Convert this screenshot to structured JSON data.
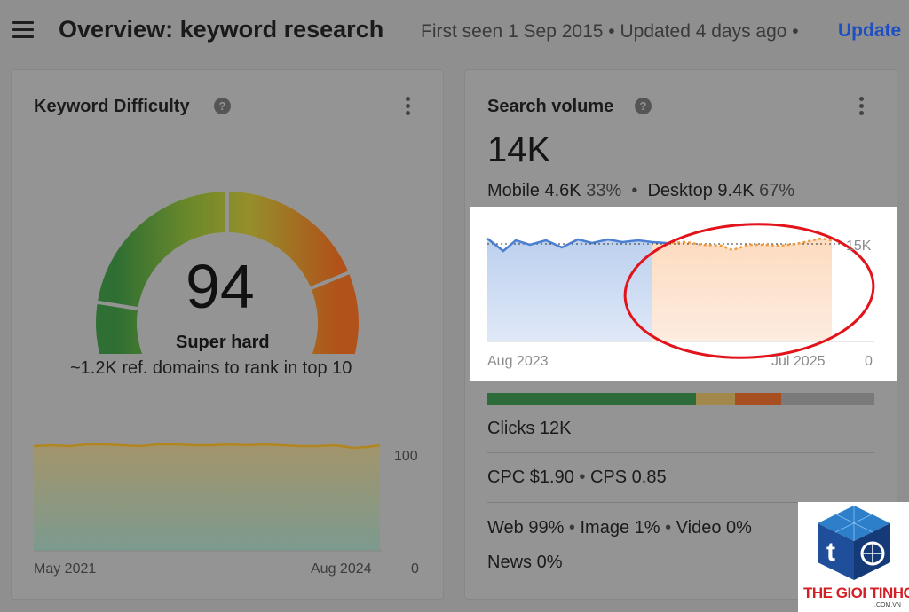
{
  "header": {
    "title": "Overview: keyword research",
    "meta": "First seen 1 Sep 2015 • Updated 4 days ago •",
    "update_label": "Update"
  },
  "keyword_difficulty": {
    "title": "Keyword Difficulty",
    "help": "?",
    "value": "94",
    "gauge_fraction": 0.94,
    "label": "Super hard",
    "subtext": "~1.2K ref. domains to rank in top 10",
    "chart": {
      "x_start": "May 2021",
      "x_end": "Aug 2024",
      "y_max": "100",
      "y_min": "0"
    }
  },
  "search_volume": {
    "title": "Search volume",
    "help": "?",
    "value": "14K",
    "mobile_label": "Mobile",
    "mobile_value": "4.6K",
    "mobile_pct": "33%",
    "desktop_label": "Desktop",
    "desktop_value": "9.4K",
    "desktop_pct": "67%",
    "chart": {
      "y_max": "15K",
      "y_min": "0",
      "x_start": "Aug 2023",
      "x_end": "Jul 2025"
    },
    "distribution": [
      {
        "fraction": 0.54,
        "color": "#2e6b3a"
      },
      {
        "fraction": 0.1,
        "color": "#a2894b"
      },
      {
        "fraction": 0.12,
        "color": "#a84f22"
      },
      {
        "fraction": 0.24,
        "color": "#7a7a7a"
      }
    ],
    "clicks": "Clicks 12K",
    "cpc": "CPC $1.90",
    "cps": "CPS 0.85",
    "web": "Web 99%",
    "image": "Image 1%",
    "video": "Video 0%",
    "news": "News 0%"
  },
  "watermark": {
    "text": "THE GIOI TINHOC",
    "subtext": ".COM.VN"
  },
  "colors": {
    "update_link": "#1d4fc2",
    "annotation_circle": "#e3131b",
    "history_line": "#4b7fd1",
    "forecast_line": "#ef9a3d"
  }
}
